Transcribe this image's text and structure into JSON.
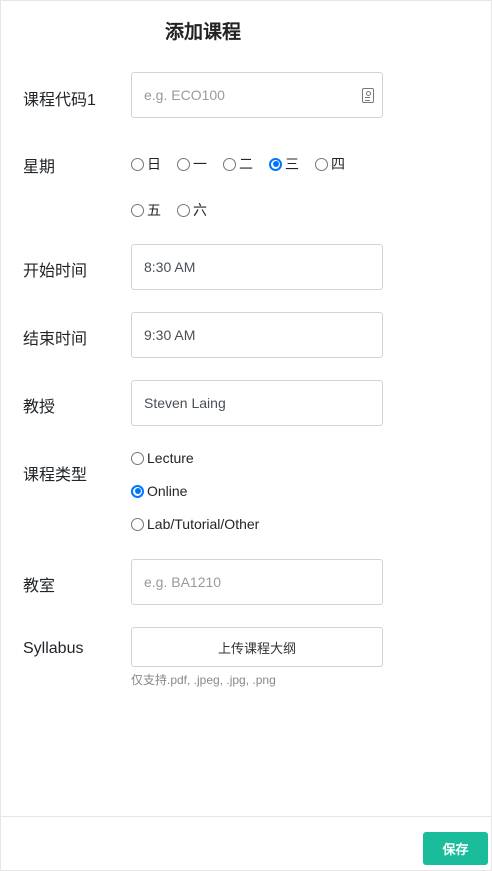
{
  "title": "添加课程",
  "course_code": {
    "label": "课程代码1",
    "placeholder": "e.g. ECO100",
    "value": ""
  },
  "weekday": {
    "label": "星期",
    "options": [
      {
        "label": "日",
        "checked": false
      },
      {
        "label": "一",
        "checked": false
      },
      {
        "label": "二",
        "checked": false
      },
      {
        "label": "三",
        "checked": true
      },
      {
        "label": "四",
        "checked": false
      },
      {
        "label": "五",
        "checked": false
      },
      {
        "label": "六",
        "checked": false
      }
    ]
  },
  "start_time": {
    "label": "开始时间",
    "value": "8:30 AM"
  },
  "end_time": {
    "label": "结束时间",
    "value": "9:30 AM"
  },
  "professor": {
    "label": "教授",
    "value": "Steven Laing"
  },
  "course_type": {
    "label": "课程类型",
    "options": [
      {
        "label": "Lecture",
        "checked": false
      },
      {
        "label": "Online",
        "checked": true
      },
      {
        "label": "Lab/Tutorial/Other",
        "checked": false
      }
    ]
  },
  "classroom": {
    "label": "教室",
    "placeholder": "e.g. BA1210",
    "value": ""
  },
  "syllabus": {
    "label": "Syllabus",
    "button_label": "上传课程大纲",
    "hint": "仅支持.pdf, .jpeg, .jpg, .png"
  },
  "footer": {
    "save_label": "保存",
    "accent_color": "#1abc9c"
  },
  "icons": {
    "course_code_field": "contact-card-icon"
  }
}
